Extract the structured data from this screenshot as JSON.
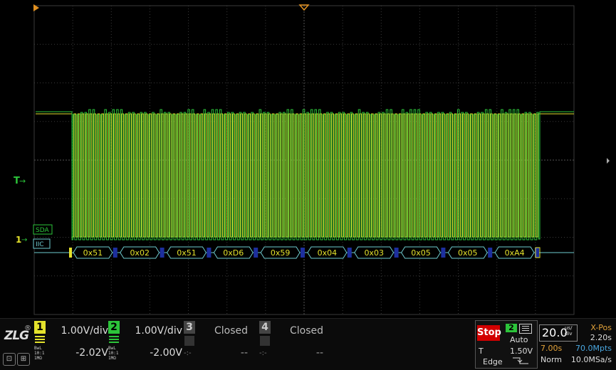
{
  "waveform": {
    "trigger_marker": "T",
    "ch1_marker": "1",
    "sda_label": "SDA",
    "bus_label": "IIC",
    "decoded_bytes": [
      "0x51",
      "0x02",
      "0x51",
      "0xD6",
      "0x59",
      "0x04",
      "0x03",
      "0x05",
      "0x05",
      "0xA4"
    ],
    "colors": {
      "ch1": "#e4e22c",
      "ch2": "#2cc43a",
      "bus": "#6ecbcf",
      "grid": "#3a3a3a",
      "trigger": "#e09020"
    }
  },
  "logo": {
    "brand": "ZLG",
    "reg": "®",
    "icon1": "disk-icon",
    "icon2": "usb-icon"
  },
  "channels": [
    {
      "num": "1",
      "meta": [
        "BwL",
        "10:1",
        "1MΩ"
      ],
      "vdiv": "1.00V/div",
      "offset": "-2.02V",
      "color": "#e4e22c",
      "state": "on"
    },
    {
      "num": "2",
      "meta": [
        "BwL",
        "10:1",
        "1MΩ"
      ],
      "vdiv": "1.00V/div",
      "offset": "-2.00V",
      "color": "#2cc43a",
      "state": "on"
    },
    {
      "num": "3",
      "meta": [
        "-:-"
      ],
      "vdiv": "Closed",
      "offset": "--",
      "state": "off"
    },
    {
      "num": "4",
      "meta": [
        "-:-"
      ],
      "vdiv": "Closed",
      "offset": "--",
      "state": "off"
    }
  ],
  "run": {
    "state": "Stop",
    "trigger_source": "2",
    "trigger_mode": "Auto",
    "trigger_label": "T",
    "trigger_level": "1.50V",
    "trigger_type": "Edge"
  },
  "timebase": {
    "value": "20.0",
    "unit_top": "us/",
    "unit_bottom": "div",
    "xpos_label": "X-Pos",
    "xpos_value": "2.20s",
    "delay": "7.00s",
    "mem_depth": "70.0Mpts",
    "acq_mode": "Norm",
    "sample_rate": "10.0MSa/s"
  }
}
